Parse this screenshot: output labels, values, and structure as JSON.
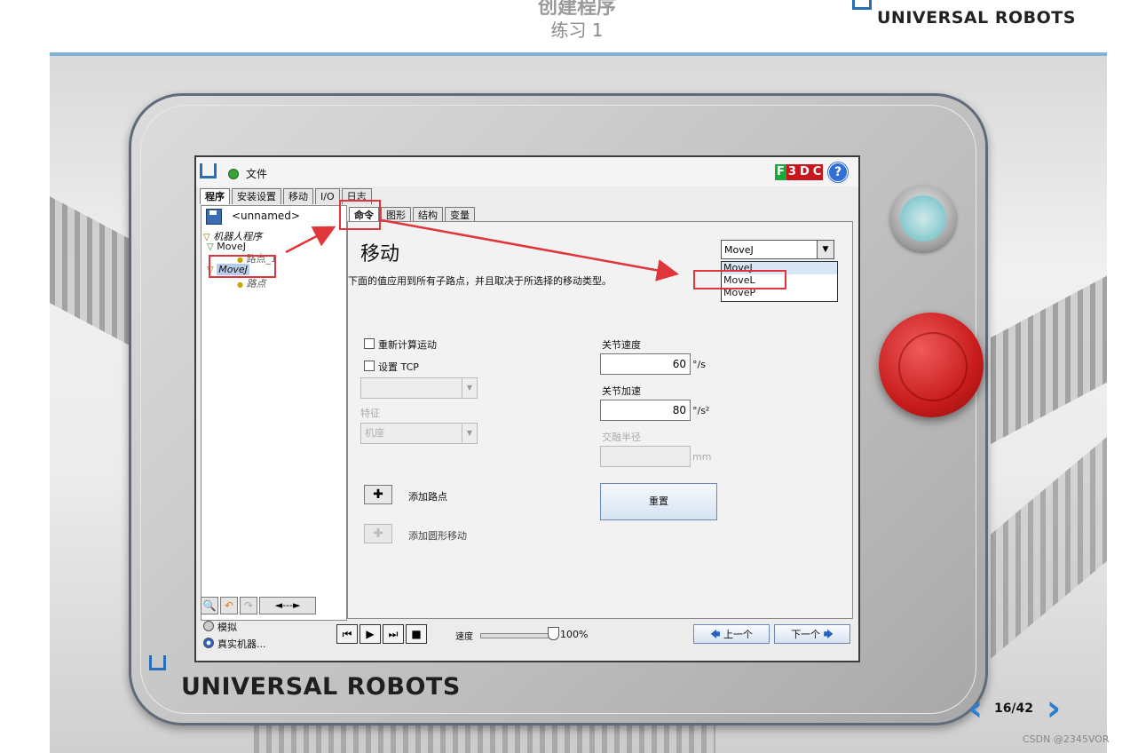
{
  "slide": {
    "title": "创建程序",
    "subtitle": "练习 1",
    "brand": "UNIVERSAL ROBOTS",
    "page": "16/42",
    "watermark": "CSDN @2345VOR"
  },
  "ur_screen": {
    "file_menu": "文件",
    "brand_badge": [
      "F",
      "3",
      "D",
      "C"
    ],
    "help": "?",
    "main_tabs": [
      "程序",
      "安装设置",
      "移动",
      "I/O",
      "日志"
    ],
    "program_name": "<unnamed>",
    "tree": {
      "root": "机器人程序",
      "move1": "MoveJ",
      "wp1": "路点_1",
      "move2": "MoveJ",
      "wp2": "路点"
    },
    "sub_tabs": [
      "命令",
      "图形",
      "结构",
      "变量"
    ],
    "command": {
      "title": "移动",
      "description": "下面的值应用到所有子路点，并且取决于所选择的移动类型。",
      "move_type": "MoveJ",
      "move_options": [
        "MoveJ",
        "MoveL",
        "MoveP"
      ],
      "recalc_label": "重新计算运动",
      "set_tcp_label": "设置 TCP",
      "feature_label": "特征",
      "feature_value": "机座",
      "joint_speed_label": "关节速度",
      "joint_speed": "60",
      "joint_speed_unit": "°/s",
      "joint_accel_label": "关节加速",
      "joint_accel": "80",
      "joint_accel_unit": "°/s²",
      "blend_label": "交融半径",
      "blend_unit": "mm",
      "reset_label": "重置",
      "add_waypoint": "添加路点",
      "add_circle": "添加圆形移动"
    },
    "left_tools": [
      "🔍",
      "↶",
      "↷",
      "◄---►"
    ],
    "run_mode": {
      "simulate": "模拟",
      "real": "真实机器..."
    },
    "playback": {
      "buttons": [
        "⏮",
        "▶",
        "⏭",
        "■"
      ],
      "speed_label": "速度",
      "speed_value": "100%",
      "speed_fraction": 1.0
    },
    "nav": {
      "prev": "上一个",
      "next": "下一个"
    }
  },
  "colors": {
    "annotation_red": "#e0353a",
    "accent_blue": "#2d7ed0"
  }
}
